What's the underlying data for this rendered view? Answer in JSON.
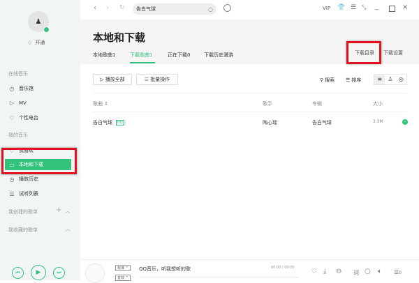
{
  "sidebar": {
    "open_label": "开通",
    "online_section": "在线音乐",
    "online_items": [
      {
        "label": "音乐馆",
        "icon": "music-hall-icon"
      },
      {
        "label": "MV",
        "icon": "mv-icon"
      },
      {
        "label": "个性电台",
        "icon": "radio-icon"
      }
    ],
    "my_section": "我的音乐",
    "my_items": [
      {
        "label": "我喜欢"
      },
      {
        "label": "本地和下载"
      },
      {
        "label": "播放历史"
      },
      {
        "label": "试听列表"
      }
    ],
    "created_playlists": "我创建的歌单",
    "collected_playlists": "我收藏的歌单"
  },
  "topbar": {
    "search_value": "告白气球",
    "vip": "VIP"
  },
  "header": {
    "title": "本地和下载",
    "tabs": [
      "本地歌曲1",
      "下载歌曲1",
      "正在下载0",
      "下载历史漫游"
    ],
    "download_dir": "下载目录",
    "download_settings": "下载设置"
  },
  "toolbar": {
    "play_all": "播放全部",
    "batch": "批量操作",
    "search": "搜索",
    "sort": "排序"
  },
  "table": {
    "headers": [
      "歌曲 ⇕",
      "歌手",
      "专辑",
      "大小"
    ],
    "rows": [
      {
        "song": "告白气球",
        "quality": "HQ",
        "artist": "陶心瑶",
        "album": "告白气球",
        "size": "3.3M"
      }
    ]
  },
  "player": {
    "quality_tag": "标准",
    "effect_tag": "音效",
    "now_playing": "QQ音乐，听我想听的歌",
    "time": "00:00 / 00:00",
    "lyric": "词",
    "playlist_count": "0"
  },
  "colors": {
    "accent": "#31c27c",
    "highlight": "#e0141e"
  }
}
